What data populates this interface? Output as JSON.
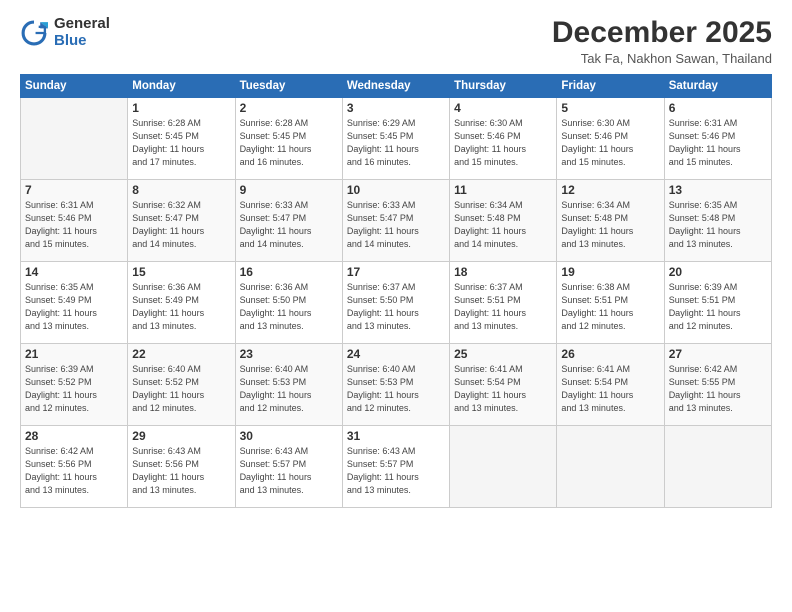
{
  "header": {
    "logo_general": "General",
    "logo_blue": "Blue",
    "month_title": "December 2025",
    "subtitle": "Tak Fa, Nakhon Sawan, Thailand"
  },
  "weekdays": [
    "Sunday",
    "Monday",
    "Tuesday",
    "Wednesday",
    "Thursday",
    "Friday",
    "Saturday"
  ],
  "weeks": [
    [
      {
        "day": "",
        "empty": true
      },
      {
        "day": "1",
        "sunrise": "6:28 AM",
        "sunset": "5:45 PM",
        "daylight": "11 hours and 17 minutes."
      },
      {
        "day": "2",
        "sunrise": "6:28 AM",
        "sunset": "5:45 PM",
        "daylight": "11 hours and 16 minutes."
      },
      {
        "day": "3",
        "sunrise": "6:29 AM",
        "sunset": "5:45 PM",
        "daylight": "11 hours and 16 minutes."
      },
      {
        "day": "4",
        "sunrise": "6:30 AM",
        "sunset": "5:46 PM",
        "daylight": "11 hours and 15 minutes."
      },
      {
        "day": "5",
        "sunrise": "6:30 AM",
        "sunset": "5:46 PM",
        "daylight": "11 hours and 15 minutes."
      },
      {
        "day": "6",
        "sunrise": "6:31 AM",
        "sunset": "5:46 PM",
        "daylight": "11 hours and 15 minutes."
      }
    ],
    [
      {
        "day": "7",
        "sunrise": "6:31 AM",
        "sunset": "5:46 PM",
        "daylight": "11 hours and 15 minutes."
      },
      {
        "day": "8",
        "sunrise": "6:32 AM",
        "sunset": "5:47 PM",
        "daylight": "11 hours and 14 minutes."
      },
      {
        "day": "9",
        "sunrise": "6:33 AM",
        "sunset": "5:47 PM",
        "daylight": "11 hours and 14 minutes."
      },
      {
        "day": "10",
        "sunrise": "6:33 AM",
        "sunset": "5:47 PM",
        "daylight": "11 hours and 14 minutes."
      },
      {
        "day": "11",
        "sunrise": "6:34 AM",
        "sunset": "5:48 PM",
        "daylight": "11 hours and 14 minutes."
      },
      {
        "day": "12",
        "sunrise": "6:34 AM",
        "sunset": "5:48 PM",
        "daylight": "11 hours and 13 minutes."
      },
      {
        "day": "13",
        "sunrise": "6:35 AM",
        "sunset": "5:48 PM",
        "daylight": "11 hours and 13 minutes."
      }
    ],
    [
      {
        "day": "14",
        "sunrise": "6:35 AM",
        "sunset": "5:49 PM",
        "daylight": "11 hours and 13 minutes."
      },
      {
        "day": "15",
        "sunrise": "6:36 AM",
        "sunset": "5:49 PM",
        "daylight": "11 hours and 13 minutes."
      },
      {
        "day": "16",
        "sunrise": "6:36 AM",
        "sunset": "5:50 PM",
        "daylight": "11 hours and 13 minutes."
      },
      {
        "day": "17",
        "sunrise": "6:37 AM",
        "sunset": "5:50 PM",
        "daylight": "11 hours and 13 minutes."
      },
      {
        "day": "18",
        "sunrise": "6:37 AM",
        "sunset": "5:51 PM",
        "daylight": "11 hours and 13 minutes."
      },
      {
        "day": "19",
        "sunrise": "6:38 AM",
        "sunset": "5:51 PM",
        "daylight": "11 hours and 12 minutes."
      },
      {
        "day": "20",
        "sunrise": "6:39 AM",
        "sunset": "5:51 PM",
        "daylight": "11 hours and 12 minutes."
      }
    ],
    [
      {
        "day": "21",
        "sunrise": "6:39 AM",
        "sunset": "5:52 PM",
        "daylight": "11 hours and 12 minutes."
      },
      {
        "day": "22",
        "sunrise": "6:40 AM",
        "sunset": "5:52 PM",
        "daylight": "11 hours and 12 minutes."
      },
      {
        "day": "23",
        "sunrise": "6:40 AM",
        "sunset": "5:53 PM",
        "daylight": "11 hours and 12 minutes."
      },
      {
        "day": "24",
        "sunrise": "6:40 AM",
        "sunset": "5:53 PM",
        "daylight": "11 hours and 12 minutes."
      },
      {
        "day": "25",
        "sunrise": "6:41 AM",
        "sunset": "5:54 PM",
        "daylight": "11 hours and 13 minutes."
      },
      {
        "day": "26",
        "sunrise": "6:41 AM",
        "sunset": "5:54 PM",
        "daylight": "11 hours and 13 minutes."
      },
      {
        "day": "27",
        "sunrise": "6:42 AM",
        "sunset": "5:55 PM",
        "daylight": "11 hours and 13 minutes."
      }
    ],
    [
      {
        "day": "28",
        "sunrise": "6:42 AM",
        "sunset": "5:56 PM",
        "daylight": "11 hours and 13 minutes."
      },
      {
        "day": "29",
        "sunrise": "6:43 AM",
        "sunset": "5:56 PM",
        "daylight": "11 hours and 13 minutes."
      },
      {
        "day": "30",
        "sunrise": "6:43 AM",
        "sunset": "5:57 PM",
        "daylight": "11 hours and 13 minutes."
      },
      {
        "day": "31",
        "sunrise": "6:43 AM",
        "sunset": "5:57 PM",
        "daylight": "11 hours and 13 minutes."
      },
      {
        "day": "",
        "empty": true
      },
      {
        "day": "",
        "empty": true
      },
      {
        "day": "",
        "empty": true
      }
    ]
  ],
  "labels": {
    "sunrise": "Sunrise:",
    "sunset": "Sunset:",
    "daylight": "Daylight:"
  }
}
